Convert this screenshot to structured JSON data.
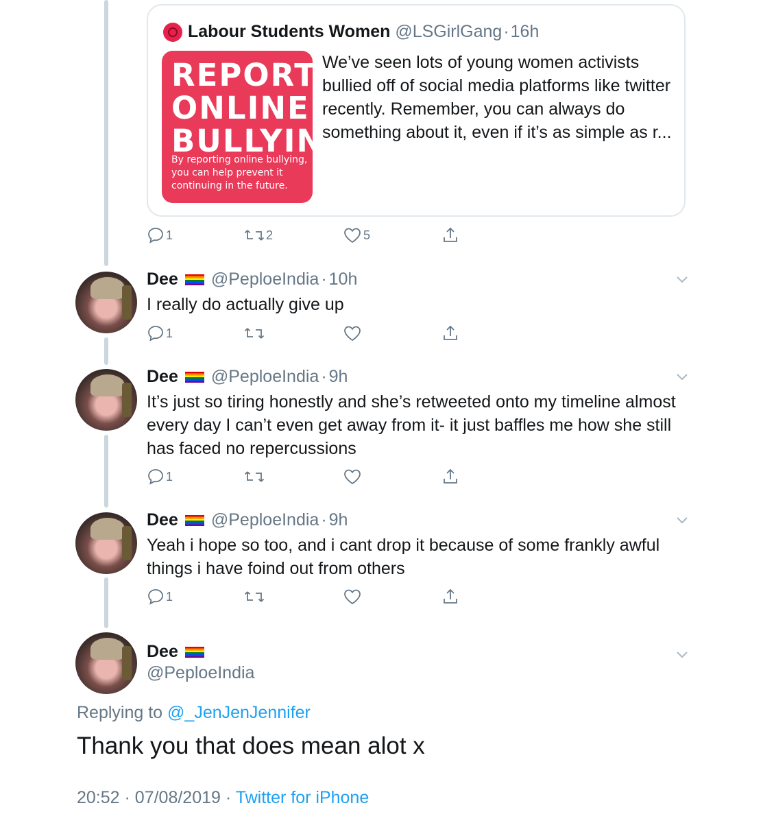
{
  "quoted": {
    "name": "Labour Students Women",
    "handle": "@LSGirlGang",
    "separator": "·",
    "time": "16h",
    "image_title": "REPORT\nONLINE\nBULLYIN",
    "image_subtitle": "By reporting online bullying, you can help prevent it continuing in the future.",
    "text": "We’ve seen lots of young women activists bullied off of social media platforms like twitter recently. Remember, you can always do something about it, even if it’s as simple as r...",
    "reply_count": "1",
    "retweet_count": "2",
    "like_count": "5"
  },
  "replies": [
    {
      "name": "Dee",
      "handle": "@PeploeIndia",
      "separator": "·",
      "time": "10h",
      "text": "I really do actually give up",
      "reply_count": "1"
    },
    {
      "name": "Dee",
      "handle": "@PeploeIndia",
      "separator": "·",
      "time": "9h",
      "text": "It’s just so tiring honestly and she’s retweeted onto my timeline almost every day I can’t even get away from it- it just baffles me how she still has faced no repercussions",
      "reply_count": "1"
    },
    {
      "name": "Dee",
      "handle": "@PeploeIndia",
      "separator": "·",
      "time": "9h",
      "text": "Yeah i hope so too, and i cant drop it because of some frankly awful things i have foind out from others",
      "reply_count": "1"
    }
  ],
  "main_tweet": {
    "name": "Dee",
    "handle": "@PeploeIndia",
    "replying_prefix": "Replying to",
    "replying_to": "@_JenJenJennifer",
    "text": "Thank you that does mean alot x",
    "time": "20:52",
    "date": "07/08/2019",
    "separator": "·",
    "source": "Twitter for iPhone"
  },
  "colors": {
    "accent": "#1da1f2",
    "muted": "#657786",
    "thread_line": "#ccd6dd",
    "quote_image": "#e93a5a"
  },
  "icons": [
    "reply-icon",
    "retweet-icon",
    "like-icon",
    "share-icon",
    "chevron-down-icon",
    "rainbow-flag-icon"
  ]
}
